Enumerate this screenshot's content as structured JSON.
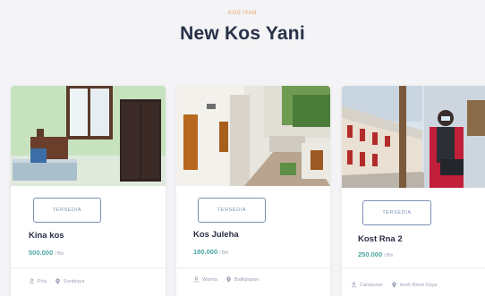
{
  "header": {
    "eyebrow": "KOS IYAN",
    "title": "New Kos Yani"
  },
  "listings": [
    {
      "status": "TERSEDIA",
      "name": "Kina kos",
      "price": "500.000",
      "per": "/ Bln",
      "type": "Pria",
      "type_icon": "user-icon",
      "location": "Surabaya",
      "location_icon": "map-pin-icon"
    },
    {
      "status": "TERSEDIA",
      "name": "Kos Juleha",
      "price": "180.000",
      "per": "/ Bln",
      "type": "Wanita",
      "type_icon": "user-icon",
      "location": "Balikpapan",
      "location_icon": "map-pin-icon"
    },
    {
      "status": "TERSEDIA",
      "name": "Kost Rna 2",
      "price": "250.000",
      "per": "/ Bln",
      "type": "Campuran",
      "type_icon": "user-icon",
      "location": "Aceh Barat Daya",
      "location_icon": "map-pin-icon"
    }
  ],
  "colors": {
    "accent": "#e2a35a",
    "price": "#4aa8a2",
    "button_border": "#7c8fb3",
    "title": "#283048"
  }
}
